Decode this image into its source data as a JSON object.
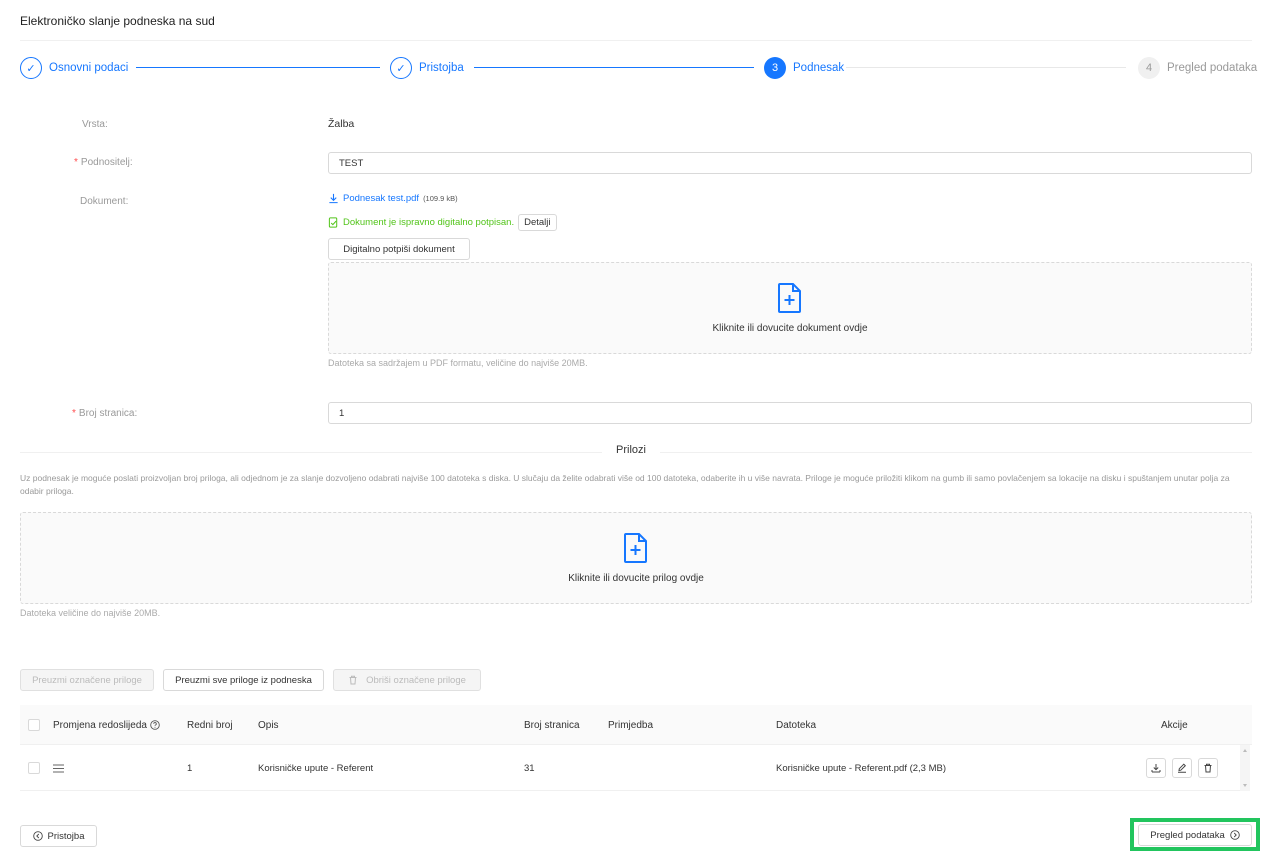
{
  "page": {
    "title": "Elektroničko slanje podneska na sud"
  },
  "steps": [
    {
      "num": "✓",
      "label": "Osnovni podaci",
      "status": "done"
    },
    {
      "num": "✓",
      "label": "Pristojba",
      "status": "done"
    },
    {
      "num": "3",
      "label": "Podnesak",
      "status": "active"
    },
    {
      "num": "4",
      "label": "Pregled podataka",
      "status": "wait"
    }
  ],
  "form": {
    "vrsta_label": "Vrsta:",
    "vrsta_value": "Žalba",
    "podnositelj_label": "Podnositelj:",
    "podnositelj_value": "TEST",
    "dokument_label": "Dokument:",
    "file_name": "Podnesak test.pdf",
    "file_size": "(109.9 kB)",
    "signed_text": "Dokument je ispravno digitalno potpisan.",
    "details_button": "Detalji",
    "sign_button": "Digitalno potpiši dokument",
    "dropzone_text": "Kliknite ili dovucite dokument ovdje",
    "dropzone_hint": "Datoteka sa sadržajem u PDF formatu, veličine do najviše 20MB.",
    "pages_label": "Broj stranica:",
    "pages_value": "1"
  },
  "attachments": {
    "title": "Prilozi",
    "description": "Uz podnesak je moguće poslati proizvoljan broj priloga, ali odjednom je za slanje dozvoljeno odabrati najviše 100 datoteka s diska. U slučaju da želite odabrati više od 100 datoteka, odaberite ih u više navrata. Priloge je moguće priložiti klikom na gumb ili samo povlačenjem sa lokacije na disku i spuštanjem unutar polja za odabir priloga.",
    "dropzone_text": "Kliknite ili dovucite prilog ovdje",
    "dropzone_hint": "Datoteka veličine do najviše 20MB.",
    "download_selected": "Preuzmi označene priloge",
    "download_all": "Preuzmi sve priloge iz podneska",
    "delete_selected": "Obriši označene priloge"
  },
  "table": {
    "columns": {
      "reorder": "Promjena redoslijeda",
      "ordinal": "Redni broj",
      "description": "Opis",
      "pages": "Broj stranica",
      "note": "Primjedba",
      "file": "Datoteka",
      "actions": "Akcije"
    },
    "rows": [
      {
        "ordinal": "1",
        "description": "Korisničke upute - Referent",
        "pages": "31",
        "note": "",
        "file": "Korisničke upute - Referent.pdf (2,3 MB)"
      }
    ]
  },
  "footer": {
    "back_button": "Pristojba",
    "next_button": "Pregled podataka"
  },
  "colors": {
    "primary": "#1677ff",
    "success": "#52c41a",
    "required": "#ff4d4f",
    "highlight": "#22c55e"
  }
}
